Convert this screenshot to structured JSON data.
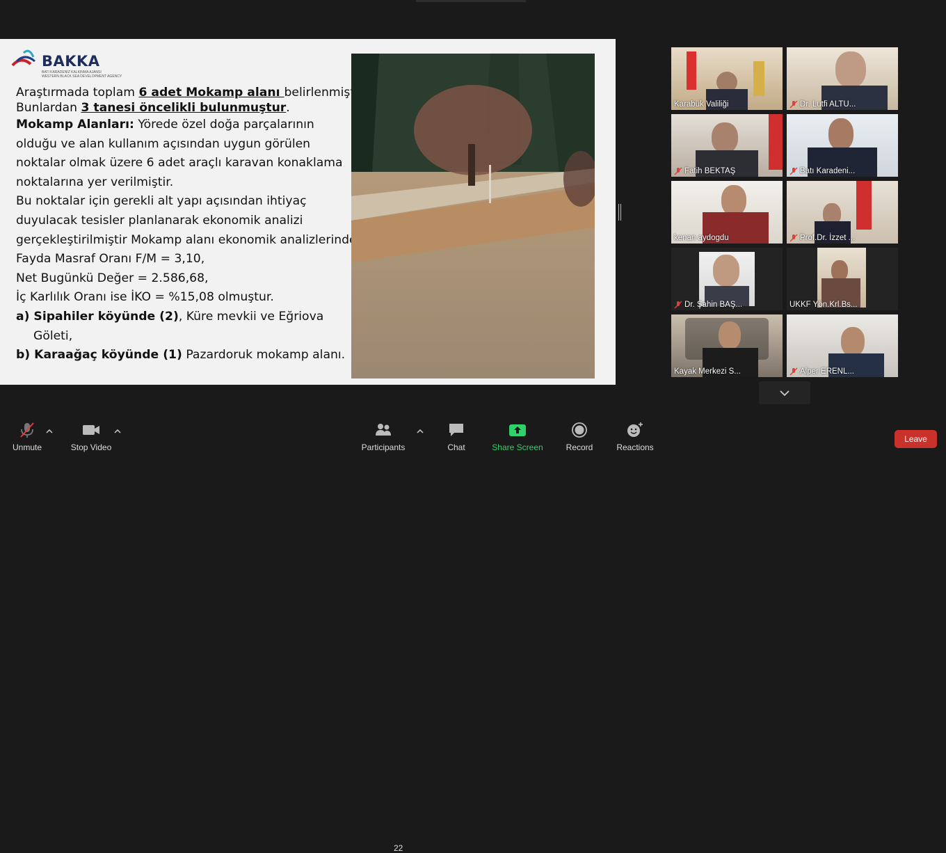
{
  "slide": {
    "logo": {
      "brand": "BAKKA",
      "sub1": "BATI KARADENİZ KALKINMA AJANSI",
      "sub2": "WESTERN BLACK SEA DEVELOPMENT AGENCY"
    },
    "l1a": "Araştırmada toplam ",
    "l1b": "6 adet Mokamp alanı ",
    "l1c": "belirlenmiştir.",
    "l2a": "Bunlardan ",
    "l2b": "3 tanesi öncelikli bulunmuştur",
    "l2c": ".",
    "l3a": "Mokamp Alanları:",
    "l3b": " Yörede özel doğa parçalarının",
    "l4": "olduğu ve alan kullanım açısından uygun görülen",
    "l5": "noktalar olmak üzere 6 adet araçlı karavan konaklama",
    "l6": "noktalarına yer verilmiştir.",
    "l7": "Bu noktalar için gerekli alt yapı açısından ihtiyaç",
    "l8": "duyulacak tesisler planlanarak ekonomik analizi",
    "l9": "gerçekleştirilmiştir Mokamp alanı ekonomik analizlerinde;",
    "l10": "Fayda Masraf Oranı F/M = 3,10,",
    "l11": "Net Bugünkü Değer = 2.586,68,",
    "l12": "İç Karlılık Oranı ise İKO = %15,08 olmuştur.",
    "l13a": "a) Sipahiler köyünde (2)",
    "l13b": ", Küre mevkii ve Eğriova",
    "l14": "Göleti,",
    "l15a": "b) Karaağaç köyünde (1)",
    "l15b": " Pazardoruk mokamp alanı."
  },
  "participants_gallery": [
    {
      "name": "Karabük Valiliği",
      "muted": false
    },
    {
      "name": "Dr. Lutfi ALTU...",
      "muted": true
    },
    {
      "name": "Fatih BEKTAŞ",
      "muted": true
    },
    {
      "name": "Batı Karadeni...",
      "muted": true
    },
    {
      "name": "kenan aydogdu",
      "muted": false
    },
    {
      "name": "Prof.Dr. İzzet ...",
      "muted": true
    },
    {
      "name": "Dr. Şahin BAŞ...",
      "muted": true
    },
    {
      "name": "UKKF Yön.Krl.Bs...",
      "muted": false
    },
    {
      "name": "Kayak Merkezi S...",
      "muted": false
    },
    {
      "name": "Alper ERENL...",
      "muted": true
    }
  ],
  "toolbar": {
    "unmute": "Unmute",
    "stop_video": "Stop Video",
    "participants": "Participants",
    "participants_count": "22",
    "chat": "Chat",
    "share_screen": "Share Screen",
    "record": "Record",
    "reactions": "Reactions",
    "leave": "Leave"
  },
  "colors": {
    "share_green": "#2fd16a",
    "leave_red": "#c9322b",
    "mute_red": "#e0403a"
  }
}
